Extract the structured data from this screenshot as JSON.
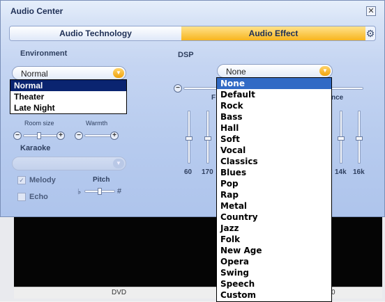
{
  "window": {
    "title": "Audio Center",
    "close_glyph": "✕"
  },
  "tabs": [
    {
      "label": "Audio Technology",
      "active": false
    },
    {
      "label": "Audio Effect",
      "active": true
    }
  ],
  "environment": {
    "label": "Environment",
    "selected": "Normal",
    "options": [
      "Normal",
      "Theater",
      "Late Night"
    ],
    "room_size_label": "Room size",
    "warmth_label": "Warmth"
  },
  "karaoke": {
    "label": "Karaoke",
    "selected": "",
    "melody_label": "Melody",
    "echo_label": "Echo",
    "pitch_label": "Pitch",
    "pitch_flat": "♭",
    "pitch_sharp": "#"
  },
  "dsp": {
    "label": "DSP",
    "selected": "None",
    "options": [
      "None",
      "Default",
      "Rock",
      "Bass",
      "Hall",
      "Soft",
      "Vocal",
      "Classics",
      "Blues",
      "Pop",
      "Rap",
      "Metal",
      "Country",
      "Jazz",
      "Folk",
      "New Age",
      "Opera",
      "Swing",
      "Speech",
      "Custom"
    ],
    "eq_bands": [
      "60",
      "170",
      "14k",
      "16k"
    ],
    "partial_label_left": "F",
    "partial_label_right": "nce"
  },
  "status_bar": {
    "source": "DVD",
    "right_text": "0"
  },
  "icons": {
    "minus": "minus-icon",
    "plus": "plus-icon",
    "gear": "gear-icon",
    "close": "close-icon"
  },
  "colors": {
    "active_tab": "#f7b51e",
    "selected_env": "#0a2470",
    "selected_dsp": "#316ac5",
    "panel": "#c5d5f2"
  }
}
